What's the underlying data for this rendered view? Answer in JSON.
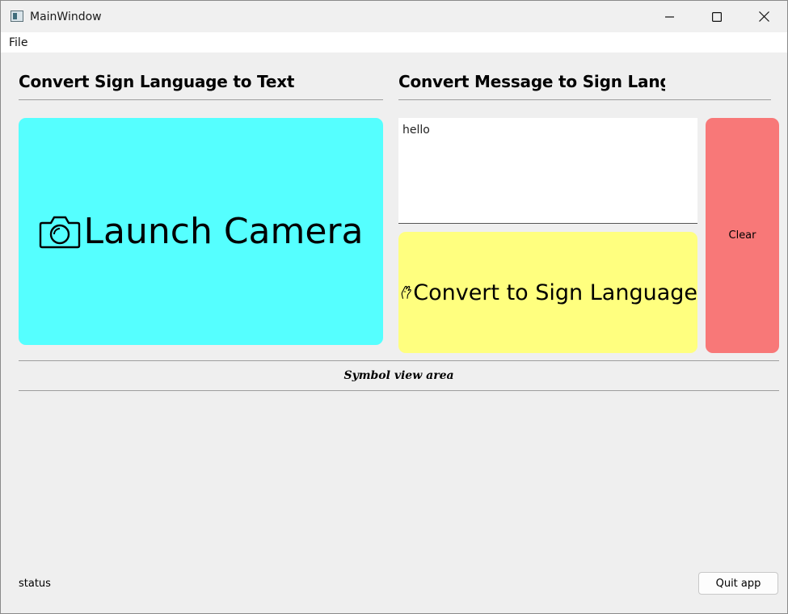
{
  "window": {
    "title": "MainWindow",
    "icon": "app-window-icon"
  },
  "titlebar_buttons": {
    "minimize_icon": "minimize-icon",
    "maximize_icon": "maximize-icon",
    "close_icon": "close-icon"
  },
  "menubar": {
    "items": [
      {
        "label": "File"
      }
    ]
  },
  "left_panel": {
    "title": "Convert Sign Language to Text",
    "camera_button": {
      "label": "Launch Camera",
      "icon": "camera-icon",
      "color": "#55ffff"
    }
  },
  "right_panel": {
    "title": "Convert Message to Sign Language",
    "message_input": {
      "value": "hello"
    },
    "convert_button": {
      "label": "Convert to Sign Language",
      "icon": "hand-sign-icon",
      "color": "#ffff7f"
    },
    "clear_button": {
      "label": "Clear",
      "color": "#f87878"
    }
  },
  "symbol_view": {
    "label": "Symbol view area"
  },
  "footer": {
    "status": "status",
    "quit_label": "Quit app"
  }
}
